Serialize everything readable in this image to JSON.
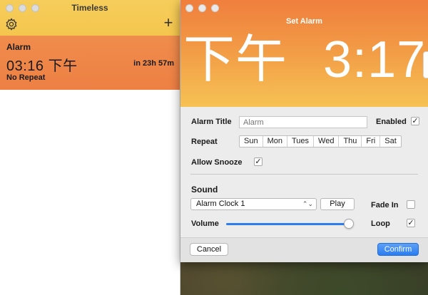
{
  "main_window": {
    "title": "Timeless",
    "gear_icon": "gear-icon",
    "add_icon": "plus-icon",
    "add_glyph": "+",
    "alarm": {
      "name": "Alarm",
      "time": "03:16 下午",
      "remaining": "in 23h 57m",
      "repeat": "No Repeat"
    }
  },
  "set_alarm": {
    "title": "Set Alarm",
    "clock": {
      "ampm": "下午",
      "time": "3:17"
    },
    "labels": {
      "alarm_title": "Alarm Title",
      "enabled": "Enabled",
      "repeat": "Repeat",
      "allow_snooze": "Allow Snooze",
      "sound": "Sound",
      "fade_in": "Fade In",
      "volume": "Volume",
      "loop": "Loop"
    },
    "title_input": {
      "placeholder": "Alarm",
      "value": ""
    },
    "checkboxes": {
      "enabled": true,
      "allow_snooze": true,
      "fade_in": false,
      "loop": true
    },
    "check_glyph": "✓",
    "days": [
      "Sun",
      "Mon",
      "Tues",
      "Wed",
      "Thu",
      "Fri",
      "Sat"
    ],
    "sound_select": {
      "value": "Alarm Clock 1",
      "updown_glyph": "⌃⌄"
    },
    "play_label": "Play",
    "volume_level": 1.0,
    "cancel_label": "Cancel",
    "confirm_label": "Confirm"
  },
  "colors": {
    "main_titlebar": "#f4c64e",
    "alarm_card": "#ee8044",
    "sheet_header_top": "#ef7f3d",
    "sheet_header_bottom": "#f6c254",
    "confirm": "#2a7df0"
  }
}
